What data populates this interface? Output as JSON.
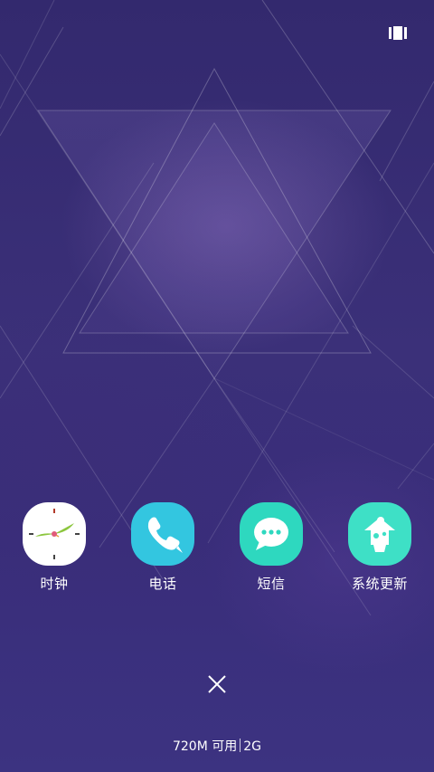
{
  "top_bar": {
    "recents_icon": "recent-apps-icon"
  },
  "apps": [
    {
      "label": "时钟",
      "icon": "clock-icon",
      "color": "#ffffff"
    },
    {
      "label": "电话",
      "icon": "phone-icon",
      "color": "#33c6e0"
    },
    {
      "label": "短信",
      "icon": "message-icon",
      "color": "#2ed8bf"
    },
    {
      "label": "系统更新",
      "icon": "system-update-icon",
      "color": "#3ee0c6"
    }
  ],
  "close_all": {
    "icon": "close-icon"
  },
  "memory": {
    "available": "720M 可用",
    "total": "2G"
  },
  "colors": {
    "background": "#3a2f78",
    "text": "#ffffff"
  }
}
